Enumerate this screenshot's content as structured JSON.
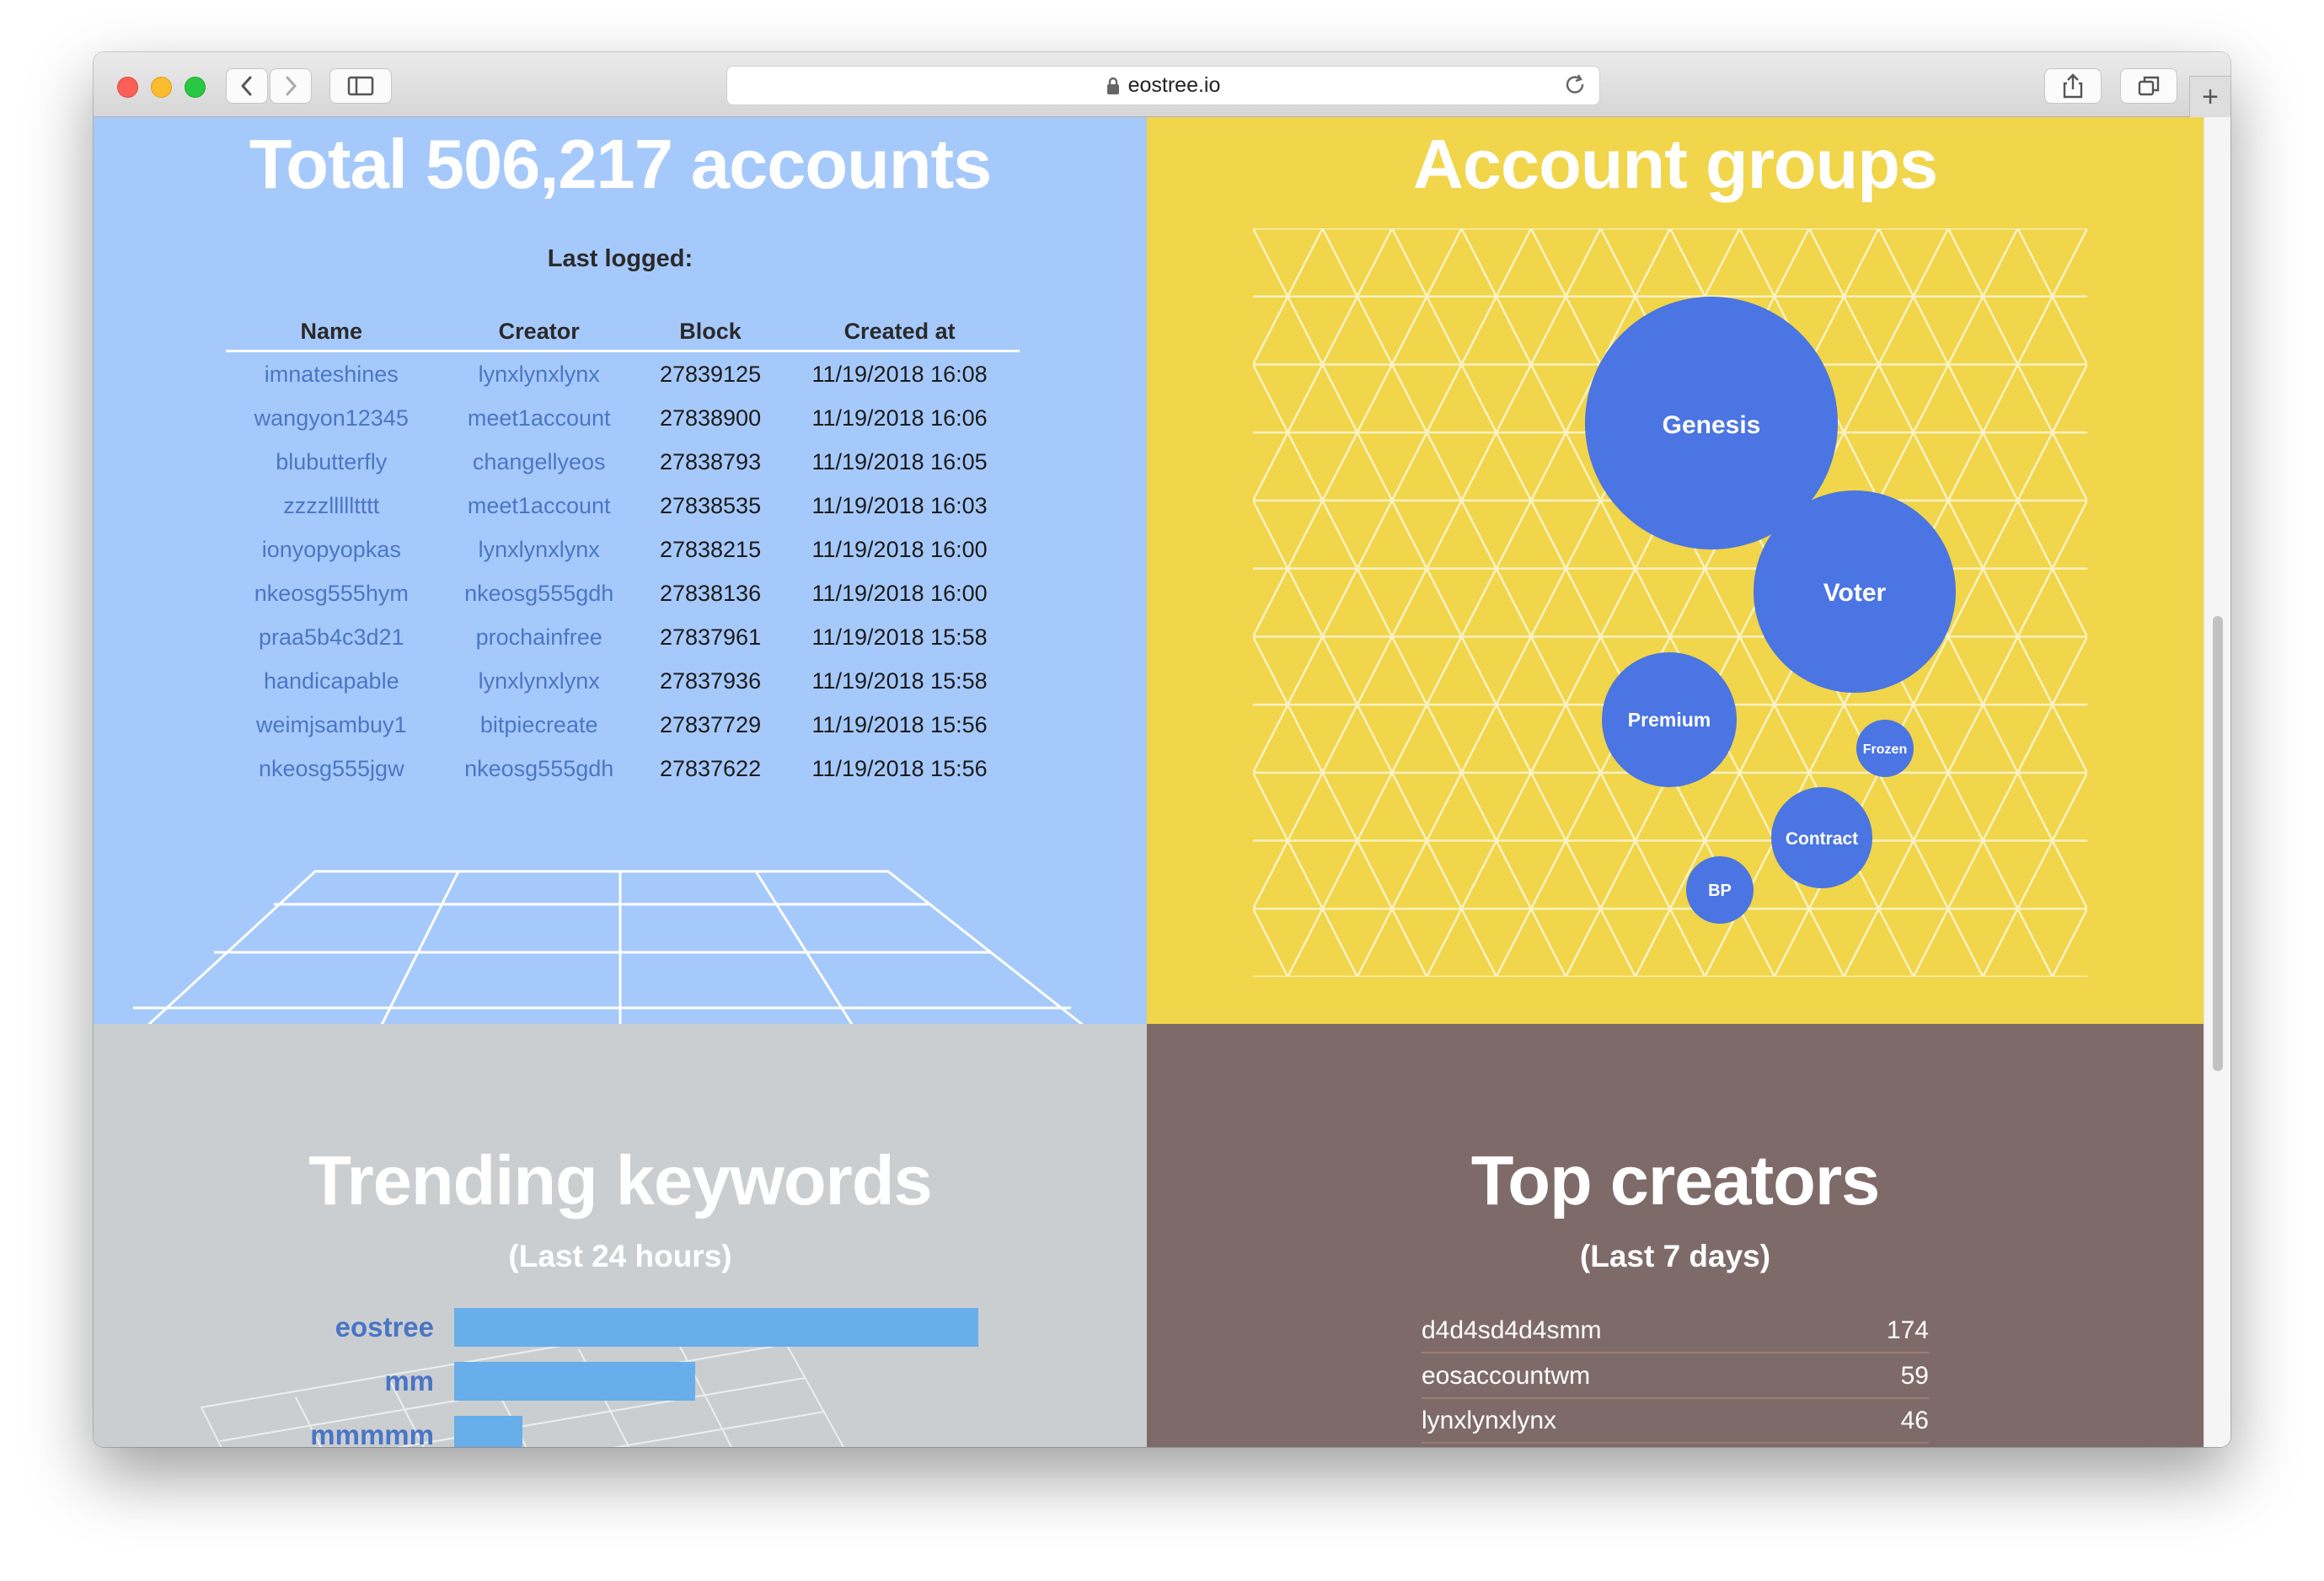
{
  "browser": {
    "url": "eostree.io",
    "icons": [
      "close-light",
      "minimize-light",
      "zoom-light",
      "back-icon",
      "forward-icon",
      "sidebar-icon",
      "lock-icon",
      "reload-icon",
      "share-icon",
      "tabs-icon",
      "plus-icon"
    ]
  },
  "accounts": {
    "title": "Total 506,217 accounts",
    "last_logged_label": "Last logged:",
    "columns": [
      "Name",
      "Creator",
      "Block",
      "Created at"
    ],
    "rows": [
      {
        "name": "imnateshines",
        "creator": "lynxlynxlynx",
        "block": "27839125",
        "created_at": "11/19/2018 16:08"
      },
      {
        "name": "wangyon12345",
        "creator": "meet1account",
        "block": "27838900",
        "created_at": "11/19/2018 16:06"
      },
      {
        "name": "blubutterfly",
        "creator": "changellyeos",
        "block": "27838793",
        "created_at": "11/19/2018 16:05"
      },
      {
        "name": "zzzzllllltttt",
        "creator": "meet1account",
        "block": "27838535",
        "created_at": "11/19/2018 16:03"
      },
      {
        "name": "ionyopyopkas",
        "creator": "lynxlynxlynx",
        "block": "27838215",
        "created_at": "11/19/2018 16:00"
      },
      {
        "name": "nkeosg555hym",
        "creator": "nkeosg555gdh",
        "block": "27838136",
        "created_at": "11/19/2018 16:00"
      },
      {
        "name": "praa5b4c3d21",
        "creator": "prochainfree",
        "block": "27837961",
        "created_at": "11/19/2018 15:58"
      },
      {
        "name": "handicapable",
        "creator": "lynxlynxlynx",
        "block": "27837936",
        "created_at": "11/19/2018 15:58"
      },
      {
        "name": "weimjsambuy1",
        "creator": "bitpiecreate",
        "block": "27837729",
        "created_at": "11/19/2018 15:56"
      },
      {
        "name": "nkeosg555jgw",
        "creator": "nkeosg555gdh",
        "block": "27837622",
        "created_at": "11/19/2018 15:56"
      }
    ]
  },
  "groups": {
    "title": "Account groups",
    "bubbles": [
      "Genesis",
      "Voter",
      "Premium",
      "Frozen",
      "Contract",
      "BP"
    ],
    "bubble_color": "#4a75e2"
  },
  "keywords": {
    "title": "Trending keywords",
    "subtitle": "(Last 24 hours)",
    "chart_data": {
      "type": "bar",
      "categories": [
        "eostree",
        "mm",
        "mmmmm"
      ],
      "values": [
        100,
        46,
        13
      ]
    }
  },
  "creators": {
    "title": "Top creators",
    "subtitle": "(Last 7 days)",
    "rows": [
      {
        "name": "d4d4sd4d4smm",
        "count": "174"
      },
      {
        "name": "eosaccountwm",
        "count": "59"
      },
      {
        "name": "lynxlynxlynx",
        "count": "46"
      }
    ]
  },
  "colors": {
    "accounts_bg": "#a6c9fb",
    "groups_bg": "#f1d54a",
    "keywords_bg": "#cbced1",
    "creators_bg": "#7e6b69",
    "link": "#4a76c4",
    "bar": "#68aeea"
  }
}
